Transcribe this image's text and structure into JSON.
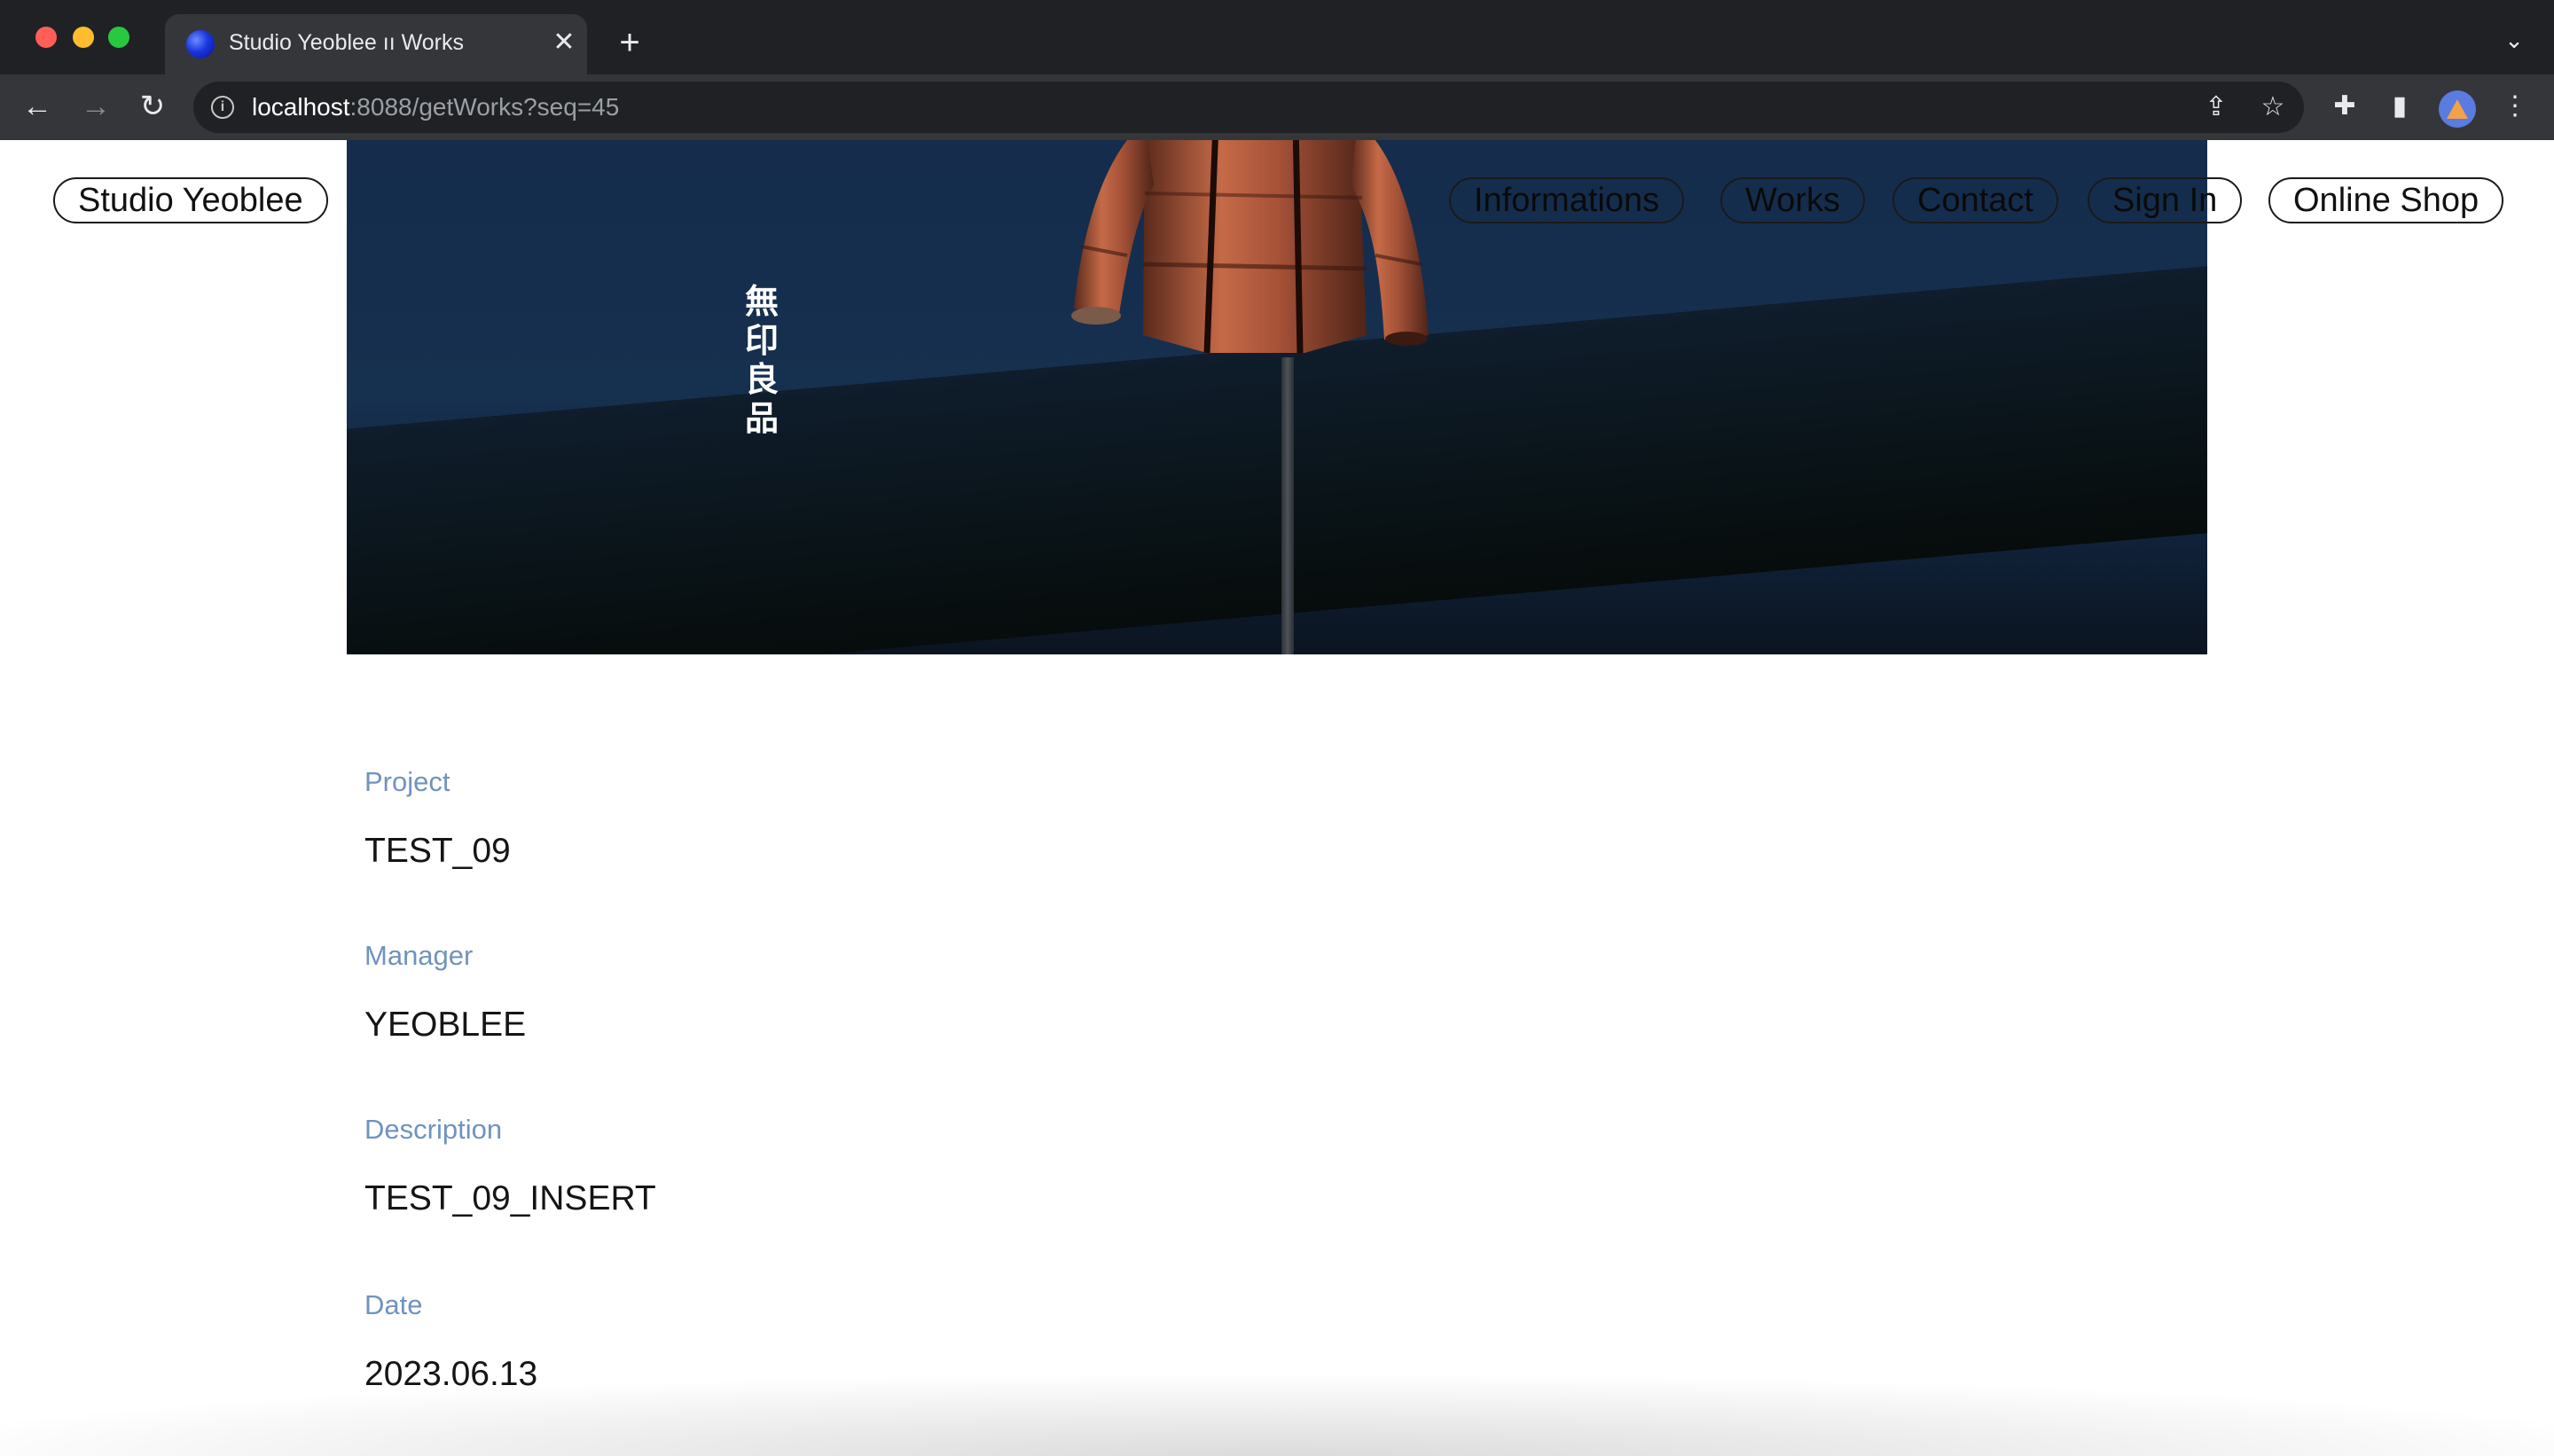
{
  "browser": {
    "tab_title": "Studio Yeoblee ıı Works",
    "tab_close_glyph": "✕",
    "new_tab_glyph": "+",
    "tab_list_glyph": "⌄",
    "url_host": "localhost",
    "url_rest": ":8088/getWorks?seq=45",
    "icons": [
      "back-arrow-icon",
      "forward-arrow-icon",
      "reload-icon",
      "info-icon",
      "share-icon",
      "star-icon",
      "extensions-icon",
      "sidebar-icon",
      "profile-avatar",
      "menu-icon"
    ]
  },
  "site": {
    "logo_label": "Studio Yeoblee",
    "nav": {
      "informations": "Informations",
      "works": "Works",
      "contact": "Contact",
      "sign_in": "Sign In",
      "online_shop": "Online Shop"
    },
    "hero": {
      "brand_chars": [
        "無",
        "印",
        "良",
        "品"
      ]
    }
  },
  "project": {
    "project_label": "Project",
    "project_value": "TEST_09",
    "manager_label": "Manager",
    "manager_value": "YEOBLEE",
    "description_label": "Description",
    "description_value": "TEST_09_INSERT",
    "date_label": "Date",
    "date_value": "2023.06.13"
  },
  "colors": {
    "chrome_dark": "#202124",
    "chrome_toolbar": "#35363a",
    "label_blue": "#6f93bf",
    "hero_navy": "#152c4c"
  }
}
